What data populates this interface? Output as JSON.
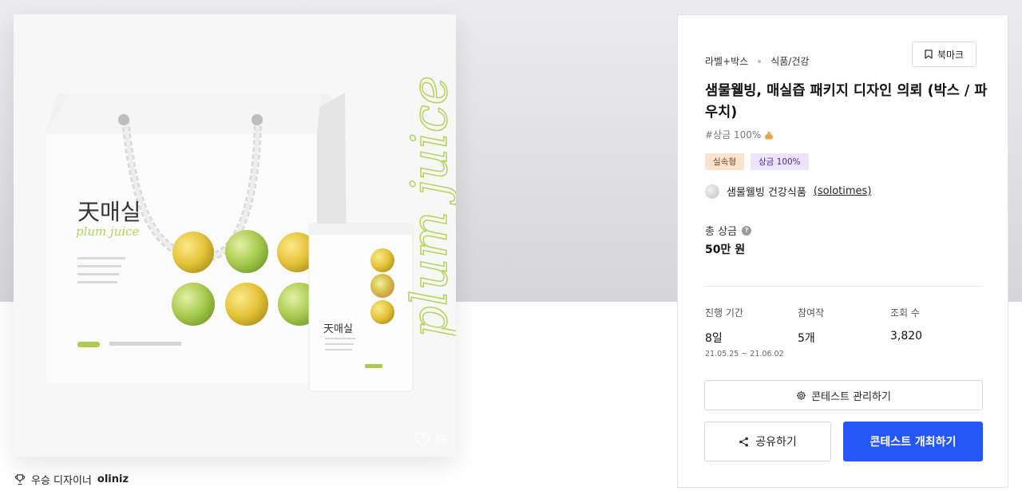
{
  "image": {
    "brand_text": "天매실",
    "script_text_small": "plum juice",
    "script_text_large": "plum juice",
    "like_count": "86",
    "icons": {
      "like": "heart-icon"
    }
  },
  "winner": {
    "label": "우승 디자이너",
    "name": "oliniz",
    "icon": "trophy-icon"
  },
  "panel": {
    "category_primary": "라벨+박스",
    "category_secondary": "식품/건강",
    "bookmark_label": "북마크",
    "title": "샘물웰빙, 매실즙 패키지 디자인 의뢰 (박스 / 파우치)",
    "hashtag": "#상금 100%",
    "badges": [
      "실속형",
      "상금 100%"
    ],
    "host_name": "샘물웰빙 건강식품",
    "host_id": "(solotimes)",
    "prize_label": "총 상금",
    "prize_value": "50만 원",
    "stats": [
      {
        "label": "진행 기간",
        "value": "8일",
        "sub": "21.05.25 ~ 21.06.02"
      },
      {
        "label": "참여작",
        "value": "5개"
      },
      {
        "label": "조회 수",
        "value": "3,820"
      }
    ],
    "manage_label": "콘테스트 관리하기",
    "share_label": "공유하기",
    "open_label": "콘테스트 개최하기",
    "colors": {
      "primary": "#2457f5",
      "badge_orange_bg": "#fae3cf",
      "badge_purple_bg": "#ece4fb"
    }
  }
}
